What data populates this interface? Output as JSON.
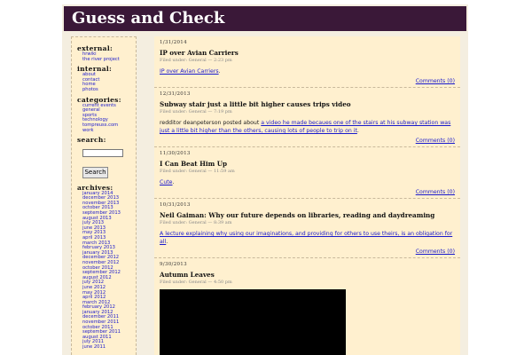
{
  "site": {
    "title": "Guess and Check"
  },
  "sidebar": {
    "external": {
      "heading": "external:",
      "items": [
        "hrwiki",
        "the river project"
      ]
    },
    "internal": {
      "heading": "internal:",
      "items": [
        "about",
        "contact",
        "home",
        "photos"
      ]
    },
    "categories": {
      "heading": "categories:",
      "items": [
        "current events",
        "general",
        "sports",
        "technology",
        "tompreuss.com",
        "work"
      ]
    },
    "search": {
      "heading": "search:",
      "value": "",
      "button": "Search"
    },
    "archives": {
      "heading": "archives:",
      "items": [
        "january 2014",
        "december 2013",
        "november 2013",
        "october 2013",
        "september 2013",
        "august 2013",
        "july 2013",
        "june 2013",
        "may 2013",
        "april 2013",
        "march 2013",
        "february 2013",
        "january 2013",
        "december 2012",
        "november 2012",
        "october 2012",
        "september 2012",
        "august 2012",
        "july 2012",
        "june 2012",
        "may 2012",
        "april 2012",
        "march 2012",
        "february 2012",
        "january 2012",
        "december 2011",
        "november 2011",
        "october 2011",
        "september 2011",
        "august 2011",
        "july 2011",
        "june 2011"
      ]
    }
  },
  "posts": [
    {
      "date": "1/31/2014",
      "title": "IP over Avian Carriers",
      "meta": "Filed under: General — 2:23 pm",
      "body_prefix": "",
      "body_link": "IP over Avian Carriers",
      "body_suffix": ".",
      "comments": "Comments (0)"
    },
    {
      "date": "12/31/2013",
      "title": "Subway stair just a little bit higher causes trips video",
      "meta": "Filed under: General — 7:19 pm",
      "body_prefix": "redditor deanpeterson posted about ",
      "body_link": "a video he made becaues one of the stairs at his subway station was just a little bit higher than the others, causing lots of people to trip on it",
      "body_suffix": ".",
      "comments": "Comments (0)"
    },
    {
      "date": "11/30/2013",
      "title": "I Can Beat Him Up",
      "meta": "Filed under: General — 11:59 am",
      "body_prefix": "",
      "body_link": "Cute",
      "body_suffix": ".",
      "comments": "Comments (0)"
    },
    {
      "date": "10/31/2013",
      "title": "Neil Gaiman: Why our future depends on libraries, reading and daydreaming",
      "meta": "Filed under: General — 8:39 am",
      "body_prefix": "",
      "body_link": "A lecture explaining why using our imaginations, and providing for others to use theirs, is an obligation for all",
      "body_suffix": ".",
      "comments": "Comments (0)"
    },
    {
      "date": "9/30/2013",
      "title": "Autumn Leaves",
      "meta": "Filed under: General — 4:50 pm"
    }
  ]
}
